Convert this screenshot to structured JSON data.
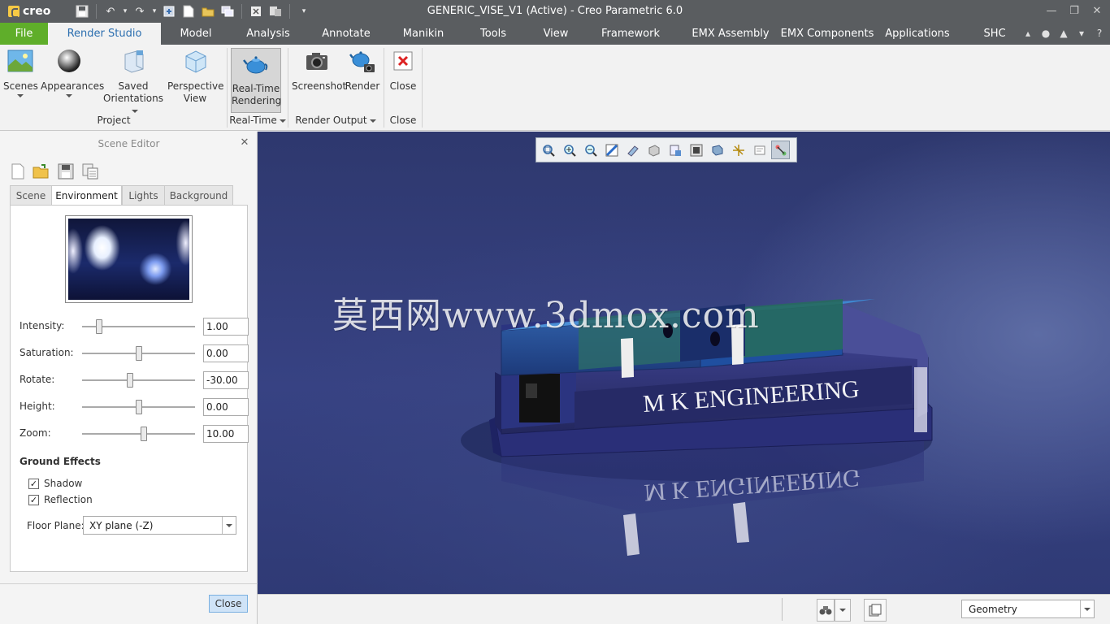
{
  "app": {
    "logo_text": "creo",
    "window_title": "GENERIC_VISE_V1 (Active) - Creo Parametric 6.0"
  },
  "menu_tabs": [
    {
      "label": "File"
    },
    {
      "label": "Render Studio"
    },
    {
      "label": "Model"
    },
    {
      "label": "Analysis"
    },
    {
      "label": "Annotate"
    },
    {
      "label": "Manikin"
    },
    {
      "label": "Tools"
    },
    {
      "label": "View"
    },
    {
      "label": "Framework"
    },
    {
      "label": "EMX Assembly"
    },
    {
      "label": "EMX Components"
    },
    {
      "label": "Applications"
    },
    {
      "label": "SHC"
    }
  ],
  "ribbon": {
    "scenes": "Scenes",
    "appearances": "Appearances",
    "saved_orientations_1": "Saved",
    "saved_orientations_2": "Orientations",
    "perspective_1": "Perspective",
    "perspective_2": "View",
    "realtime_1": "Real-Time",
    "realtime_2": "Rendering",
    "screenshot": "Screenshot",
    "render": "Render",
    "close": "Close",
    "group_project": "Project",
    "group_realtime": "Real-Time",
    "group_render_output": "Render Output",
    "group_close": "Close"
  },
  "scene_editor": {
    "title": "Scene Editor",
    "tabs": [
      "Scene",
      "Environment",
      "Lights",
      "Background"
    ],
    "active_tab": "Environment",
    "sliders": [
      {
        "label": "Intensity:",
        "value": "1.00",
        "position": 0.13
      },
      {
        "label": "Saturation:",
        "value": "0.00",
        "position": 0.5
      },
      {
        "label": "Rotate:",
        "value": "-30.00",
        "position": 0.42
      },
      {
        "label": "Height:",
        "value": "0.00",
        "position": 0.5
      },
      {
        "label": "Zoom:",
        "value": "10.00",
        "position": 0.55
      }
    ],
    "ground_effects": "Ground Effects",
    "shadow": {
      "label": "Shadow",
      "checked": true
    },
    "reflection": {
      "label": "Reflection",
      "checked": true
    },
    "floor_plane_label": "Floor Plane:",
    "floor_plane_value": "XY plane (-Z)",
    "close_button": "Close"
  },
  "viewport": {
    "watermark": "莫西网www.3dmox.com",
    "model_text": "M K ENGINEERING",
    "model_reflection_text": "M K ENGINEERING"
  },
  "statusbar": {
    "filter_value": "Geometry"
  }
}
